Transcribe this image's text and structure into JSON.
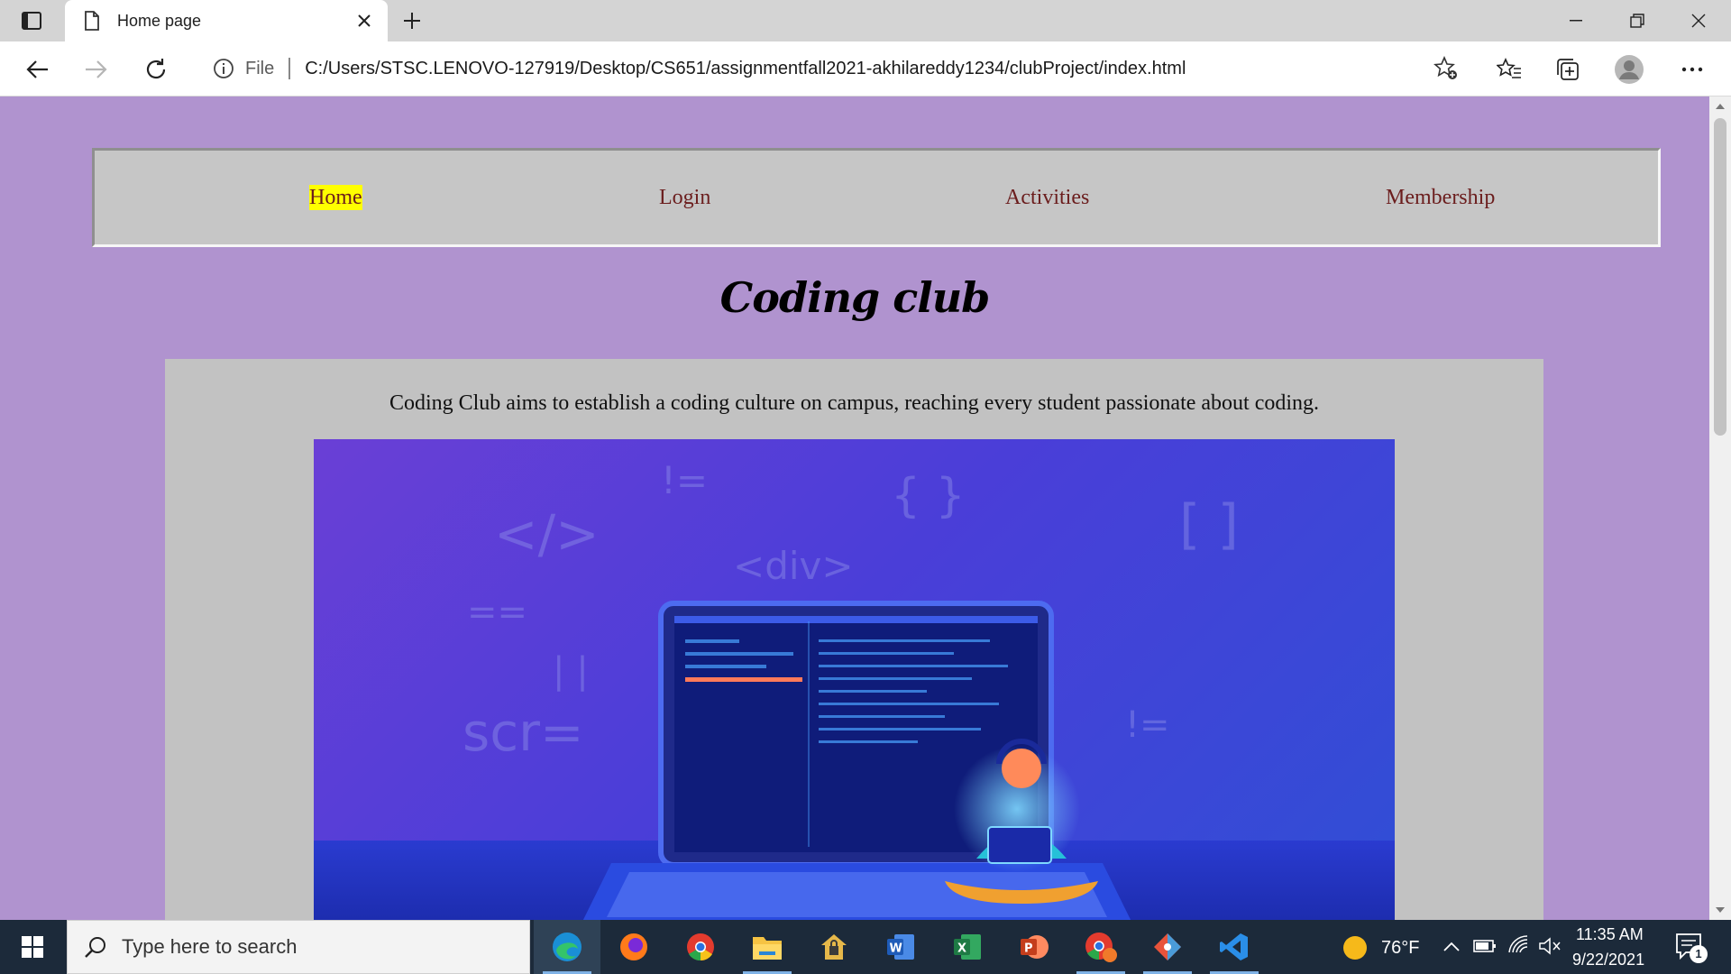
{
  "browser": {
    "tab_title": "Home page",
    "address": {
      "scheme_label": "File",
      "url": "C:/Users/STSC.LENOVO-127919/Desktop/CS651/assignmentfall2021-akhilareddy1234/clubProject/index.html"
    }
  },
  "page": {
    "nav": {
      "items": [
        {
          "label": "Home",
          "active": true
        },
        {
          "label": "Login",
          "active": false
        },
        {
          "label": "Activities",
          "active": false
        },
        {
          "label": "Membership",
          "active": false
        }
      ]
    },
    "heading": "Coding club",
    "intro": "Coding Club aims to establish a coding culture on campus, reaching every student passionate about coding.",
    "hero_symbols": [
      "</>",
      "!=",
      "{ }",
      "<div>",
      "[ ]",
      "==",
      "scr=",
      "| |",
      "!="
    ]
  },
  "taskbar": {
    "search_placeholder": "Type here to search",
    "weather": "76°F",
    "time": "11:35 AM",
    "date": "9/22/2021",
    "notification_count": "1",
    "apps": [
      "edge",
      "firefox",
      "chrome",
      "file-explorer",
      "security",
      "word",
      "excel",
      "powerpoint",
      "chrome-profile",
      "git",
      "vscode"
    ]
  },
  "colors": {
    "page_bg": "#b093cf",
    "nav_bg": "#c6c6c6",
    "nav_link": "#6b1d1d",
    "active_highlight": "#ffff00",
    "content_bg": "#c2c2c2"
  }
}
